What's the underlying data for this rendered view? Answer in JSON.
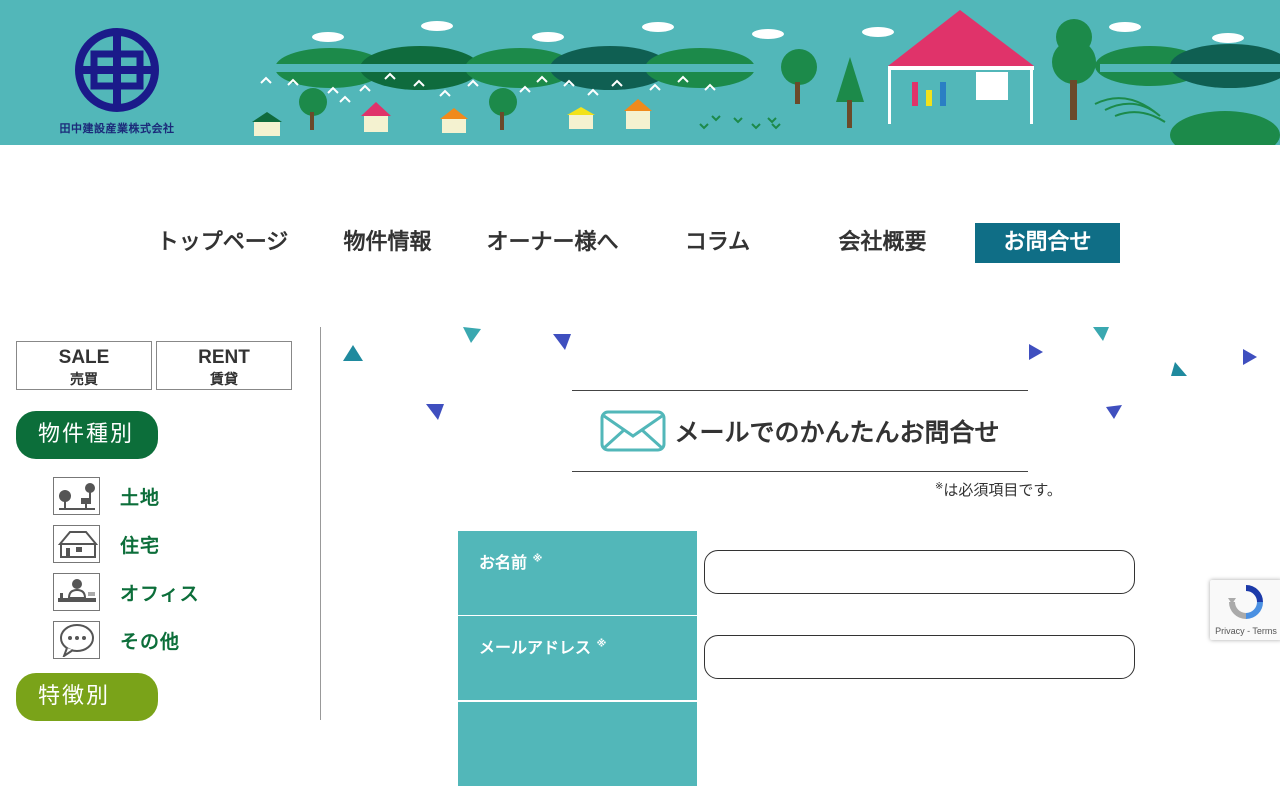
{
  "header": {
    "company_name": "田中建設産業株式会社",
    "logo_icon": "company-logo-mark",
    "banner_bg": "#52b7b9"
  },
  "nav": {
    "items": [
      {
        "label": "トップページ"
      },
      {
        "label": "物件情報"
      },
      {
        "label": "オーナー様へ"
      },
      {
        "label": "コラム"
      },
      {
        "label": "会社概要"
      },
      {
        "label": "お問合せ"
      }
    ],
    "active_index": 5,
    "active_bg": "#0f6e86"
  },
  "sidebar": {
    "tabs": [
      {
        "en": "SALE",
        "ja": "売買"
      },
      {
        "en": "RENT",
        "ja": "賃貸"
      }
    ],
    "category_heading": "物件種別",
    "categories": [
      {
        "label": "土地",
        "icon": "land-icon"
      },
      {
        "label": "住宅",
        "icon": "house-icon"
      },
      {
        "label": "オフィス",
        "icon": "office-icon"
      },
      {
        "label": "その他",
        "icon": "speech-bubble-icon"
      }
    ],
    "feature_heading": "特徴別"
  },
  "contact": {
    "title": "メールでのかんたんお問合せ",
    "required_note": "は必須項目です。",
    "required_mark": "※",
    "fields": [
      {
        "label": "お名前",
        "value": ""
      },
      {
        "label": "メールアドレス",
        "value": ""
      }
    ]
  },
  "recaptcha": {
    "links": "Privacy - Terms"
  },
  "colors": {
    "teal": "#52b7b9",
    "dark_teal": "#0f6e86",
    "green": "#0c6e3a",
    "olive": "#7aa319"
  }
}
